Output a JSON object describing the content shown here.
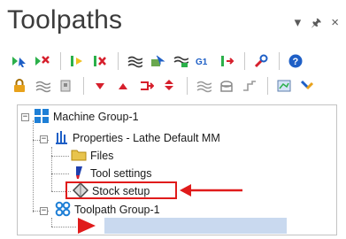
{
  "panel": {
    "title": "Toolpaths",
    "controls": {
      "dropdown": "▾",
      "pin": "║",
      "close": "×"
    }
  },
  "toolbar_row1": [
    {
      "name": "select-all-operations-icon"
    },
    {
      "name": "deselect-all-operations-icon"
    },
    {
      "name": "regenerate-selected-icon"
    },
    {
      "name": "regenerate-dirty-icon"
    },
    {
      "name": "backplot-icon"
    },
    {
      "name": "verify-icon"
    },
    {
      "name": "simulate-icon"
    },
    {
      "name": "post-g1-icon"
    },
    {
      "name": "high-feed-icon"
    },
    {
      "name": "help-icon"
    }
  ],
  "toolbar_row2": [
    {
      "name": "lock-icon"
    },
    {
      "name": "toggle-display-icon"
    },
    {
      "name": "post-toggle-icon"
    },
    {
      "name": "move-down-icon"
    },
    {
      "name": "move-up-icon"
    },
    {
      "name": "insert-arrow-icon"
    },
    {
      "name": "scroll-arrow-icon"
    },
    {
      "name": "only-show-selected-icon"
    },
    {
      "name": "only-show-associated-icon"
    },
    {
      "name": "single-selection-icon"
    },
    {
      "name": "toolpath-options-icon"
    }
  ],
  "tree": {
    "machine_group": "Machine Group-1",
    "properties": "Properties - Lathe Default MM",
    "files": "Files",
    "tool_settings": "Tool settings",
    "stock_setup": "Stock setup",
    "toolpath_group": "Toolpath Group-1",
    "collapse_glyph": "−"
  },
  "colors": {
    "accent": "#1e5fc6",
    "highlight_red": "#e01b1b",
    "selection": "#c9d9ef",
    "folder": "#e8c44d"
  }
}
